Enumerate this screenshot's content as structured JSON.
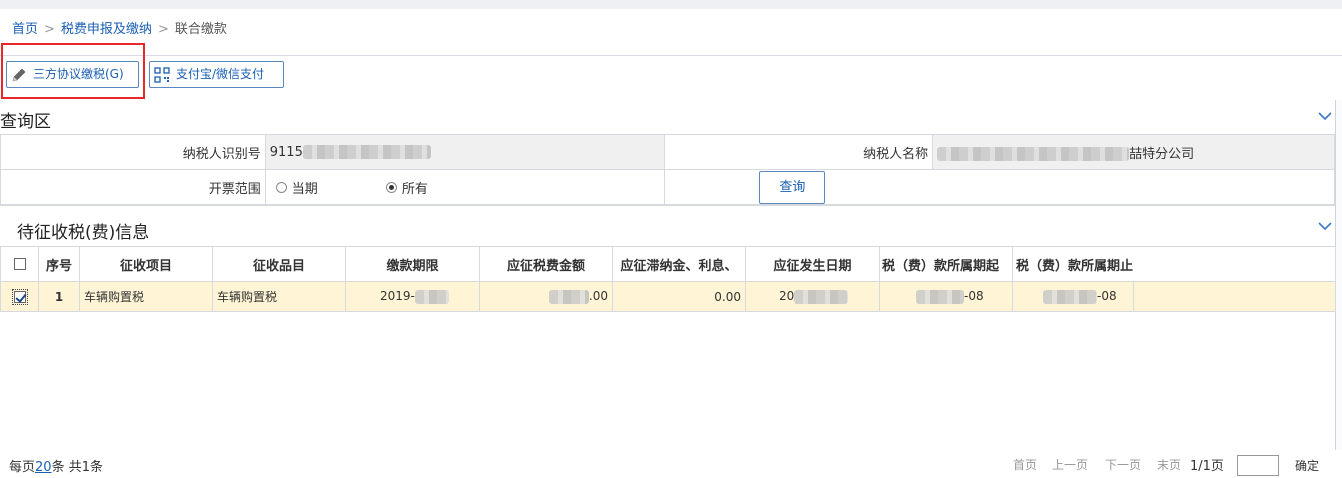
{
  "breadcrumb": {
    "home": "首页",
    "parent": "税费申报及缴纳",
    "current": "联合缴款",
    "separator": ">"
  },
  "toolbar": {
    "three_way_label": "三方协议缴税(G)",
    "three_way_icon": "pencil-icon",
    "alipay_label": "支付宝/微信支付",
    "alipay_icon": "qrcode-icon"
  },
  "query": {
    "title": "查询区",
    "taxpayer_id_label": "纳税人识别号",
    "taxpayer_id_value": "9115",
    "taxpayer_name_label": "纳税人名称",
    "taxpayer_name_suffix": "喆特分公司",
    "invoice_range_label": "开票范围",
    "radio_current": "当期",
    "radio_all": "所有",
    "selected_radio": "所有",
    "query_button": "查询"
  },
  "pending": {
    "title": "待征收税(费)信息",
    "columns": [
      "序号",
      "征收项目",
      "征收品目",
      "缴款期限",
      "应征税费金额",
      "应征滞纳金、利息、",
      "应征发生日期",
      "税（费）款所属期起",
      "税（费）款所属期止"
    ],
    "rows": [
      {
        "checked": true,
        "index": "1",
        "item": "车辆购置税",
        "subitem": "车辆购置税",
        "deadline": "2019-",
        "amount": ".00",
        "late_fee": "0.00",
        "date": "20",
        "period_start": "-08",
        "period_end": "-08"
      }
    ]
  },
  "pager": {
    "per_page_prefix": "每页",
    "per_page": "20",
    "per_page_suffix": "条 共1条",
    "first": "首页",
    "prev": "上一页",
    "next": "下一页",
    "last": "末页",
    "page_info": "1/1页",
    "confirm": "确定"
  },
  "colors": {
    "accent": "#1a5fb4",
    "highlight_border": "#e8262b",
    "selected_row": "#fff5d6"
  }
}
